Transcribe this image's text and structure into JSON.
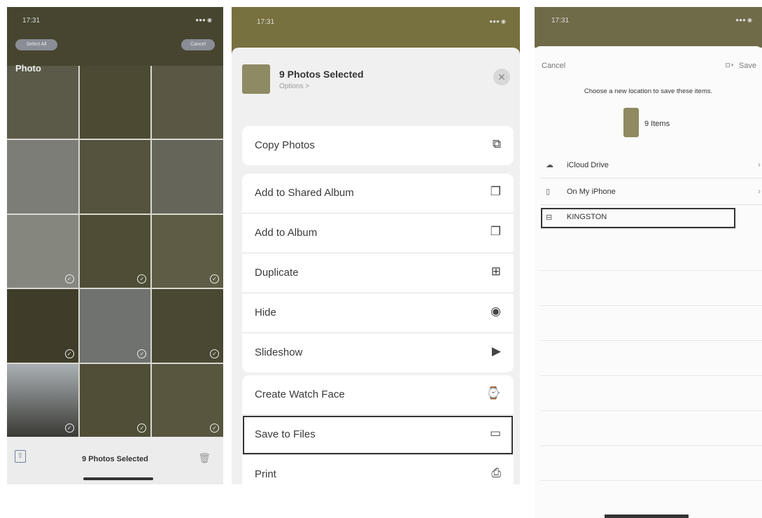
{
  "photos_grid": {
    "time": "17:31",
    "select_all_label": "Select All",
    "cancel_label": "Cancel",
    "title": "Photo",
    "selected_count_label": "9 Photos Selected"
  },
  "share_sheet": {
    "time": "17:31",
    "header_title": "9 Photos Selected",
    "header_options": "Options >",
    "groups": [
      [
        {
          "label": "Copy Photos",
          "icon": "copy-icon"
        }
      ],
      [
        {
          "label": "Add to Shared Album",
          "icon": "shared-album-icon"
        },
        {
          "label": "Add to Album",
          "icon": "album-icon"
        },
        {
          "label": "Duplicate",
          "icon": "duplicate-icon"
        },
        {
          "label": "Hide",
          "icon": "eye-icon"
        },
        {
          "label": "Slideshow",
          "icon": "play-icon"
        }
      ],
      [
        {
          "label": "Create Watch Face",
          "icon": "watch-icon"
        },
        {
          "label": "Save to Files",
          "icon": "folder-icon"
        },
        {
          "label": "Print",
          "icon": "printer-icon"
        }
      ]
    ]
  },
  "save_dialog": {
    "time": "17:31",
    "cancel_label": "Cancel",
    "save_label": "Save",
    "prompt": "Choose a new location to save these items.",
    "items_label": "9 Items",
    "locations": [
      {
        "label": "iCloud Drive",
        "icon": "cloud-icon",
        "has_chevron": true
      },
      {
        "label": "On My iPhone",
        "icon": "phone-icon",
        "has_chevron": true
      },
      {
        "label": "KINGSTON",
        "icon": "drive-icon",
        "has_chevron": false
      }
    ]
  },
  "colors": {
    "photo_tint": "#47452f",
    "sheet_bg": "#f0f0f0",
    "card_bg": "#ffffff",
    "highlight": "#333333"
  }
}
